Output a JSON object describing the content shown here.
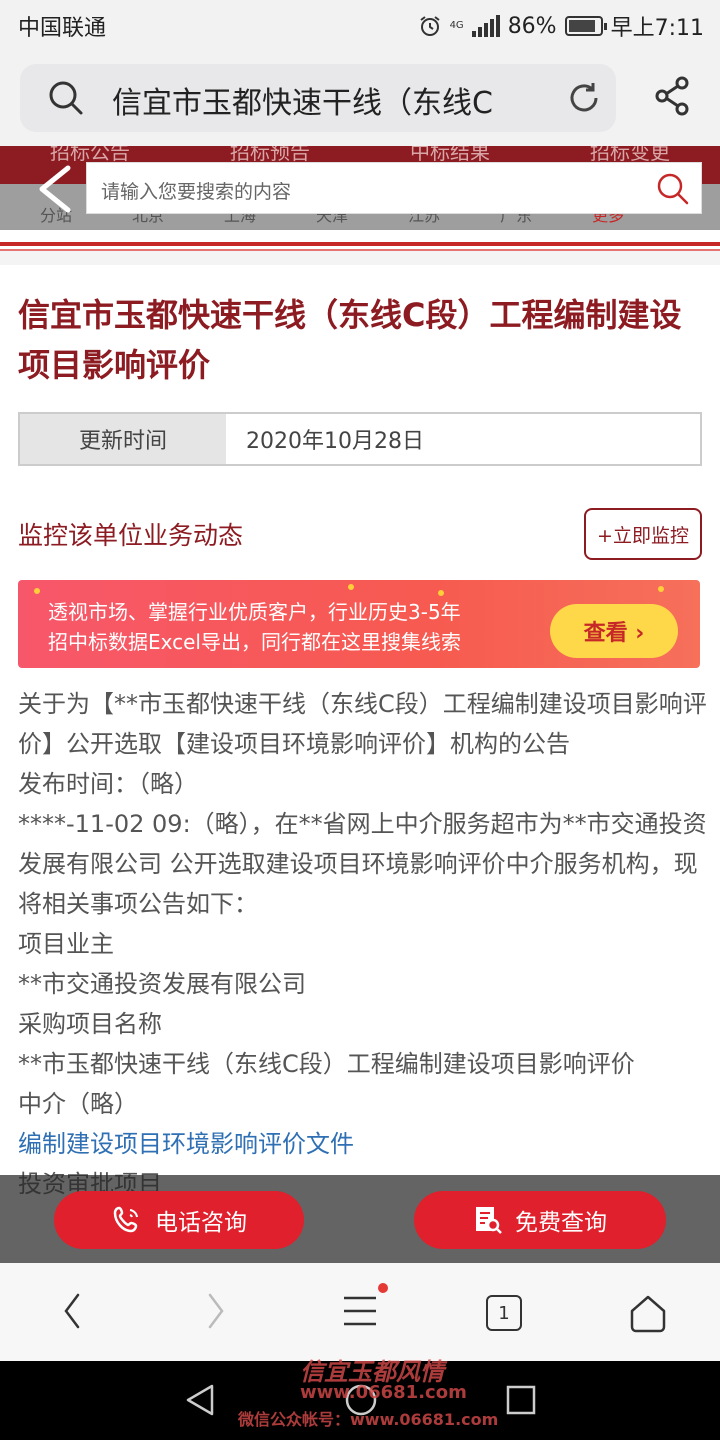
{
  "status_bar": {
    "carrier": "中国联通",
    "network": "4G",
    "battery": "86%",
    "battery_level": 0.86,
    "time": "早上7:11"
  },
  "browser": {
    "url_text": "信宜市玉都快速干线（东线C",
    "icons": [
      "search-icon",
      "reload-icon",
      "share-icon"
    ]
  },
  "site_nav": {
    "row1": [
      "招标公告",
      "招标预告",
      "中标结果",
      "招标变更"
    ],
    "row2": [
      "分站",
      "北京",
      "上海",
      "天津",
      "江苏",
      "广东",
      "更多"
    ]
  },
  "site_search": {
    "placeholder": "请输入您要搜索的内容"
  },
  "article": {
    "title": "信宜市玉都快速干线（东线C段）工程编制建设项目影响评价",
    "update_label": "更新时间",
    "update_value": "2020年10月28日",
    "monitor_text": "监控该单位业务动态",
    "monitor_button": "+立即监控",
    "paragraphs": [
      "关于为【**市玉都快速干线（东线C段）工程编制建设项目影响评价】公开选取【建设项目环境影响评价】机构的公告",
      "发布时间：（略）",
      "****-11-02 09:（略），在**省网上中介服务超市为**市交通投资发展有限公司 公开选取建设项目环境影响评价中介服务机构，现将相关事项公告如下：",
      "项目业主",
      "**市交通投资发展有限公司",
      "采购项目名称",
      "**市玉都快速干线（东线C段）工程编制建设项目影响评价",
      "中介（略）",
      "编制建设项目环境影响评价文件",
      "投资审批项目"
    ]
  },
  "banner": {
    "line1": "透视市场、掌握行业优质客户，行业历史3-5年",
    "line2": "招中标数据Excel导出，同行都在这里搜集线索",
    "cta": "查看 ›"
  },
  "actions": {
    "phone": "电话咨询",
    "query": "免费查询"
  },
  "bottom_nav": {
    "tabs_count": "1"
  },
  "watermark": {
    "line1": "信宜玉都风情",
    "line2": "www.06681.com",
    "line3": "微信公众帐号：www.06681.com"
  },
  "colors": {
    "brand": "#8d1b22",
    "accent": "#e0202c",
    "banner": "#f75a50",
    "cta": "#ffd84a"
  }
}
